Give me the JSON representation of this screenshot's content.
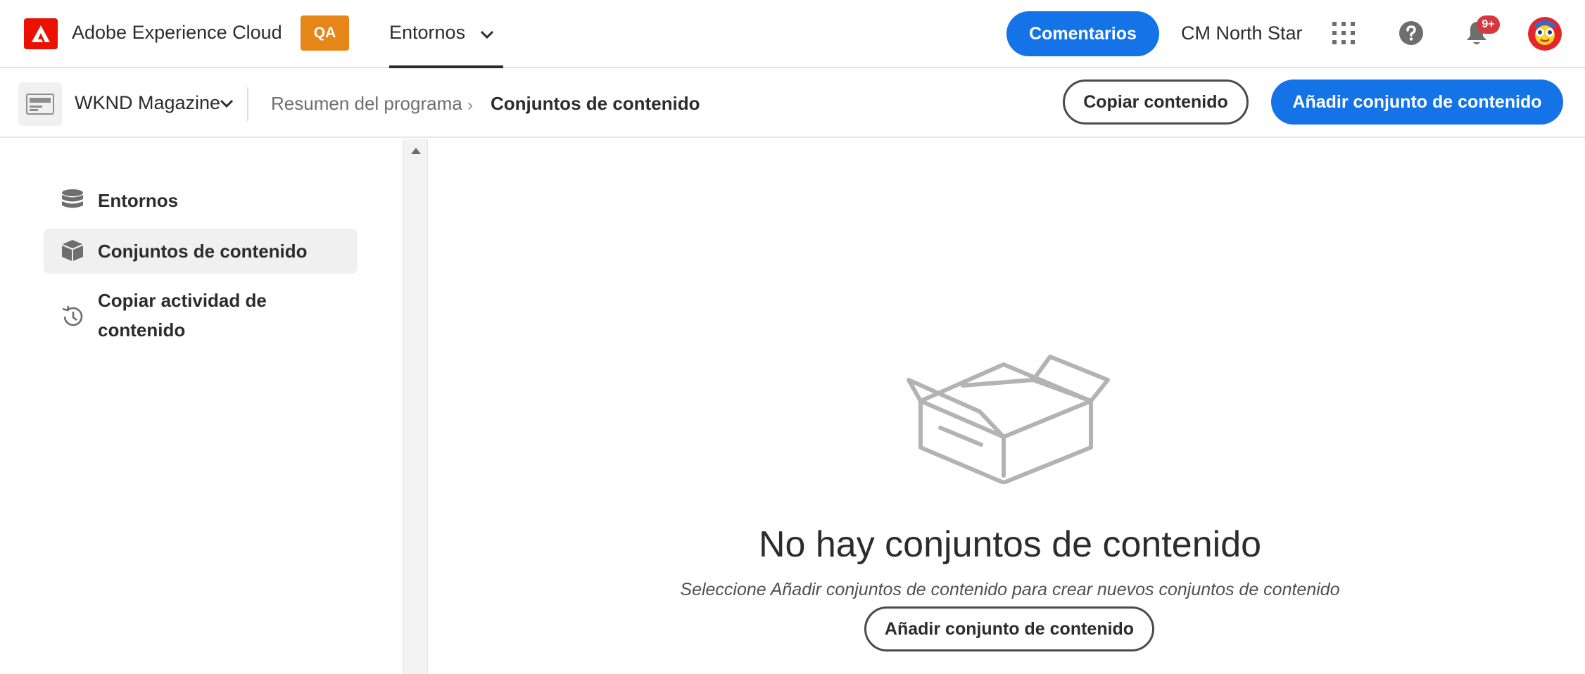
{
  "header": {
    "app_title": "Adobe Experience Cloud",
    "env_badge": "QA",
    "nav_label": "Entornos",
    "feedback_label": "Comentarios",
    "org_name": "CM North Star",
    "notification_count": "9+",
    "colors": {
      "accent": "#1473e6",
      "badge": "#e68619",
      "logo": "#eb1000",
      "notif": "#d7373f"
    }
  },
  "subheader": {
    "program_name": "WKND Magazine",
    "breadcrumb": [
      "Resumen del programa",
      "Conjuntos de contenido"
    ],
    "breadcrumb_separator": "›",
    "copy_button": "Copiar contenido",
    "add_button": "Añadir conjunto de contenido"
  },
  "sidebar": {
    "items": [
      {
        "label": "Entornos",
        "icon": "database-icon",
        "active": false
      },
      {
        "label": "Conjuntos de contenido",
        "icon": "box-icon",
        "active": true
      },
      {
        "label": "Copiar actividad de contenido",
        "icon": "history-icon",
        "active": false
      }
    ]
  },
  "empty_state": {
    "title": "No hay conjuntos de contenido",
    "description": "Seleccione Añadir conjuntos de contenido para crear nuevos conjuntos de contenido",
    "button": "Añadir conjunto de contenido"
  }
}
